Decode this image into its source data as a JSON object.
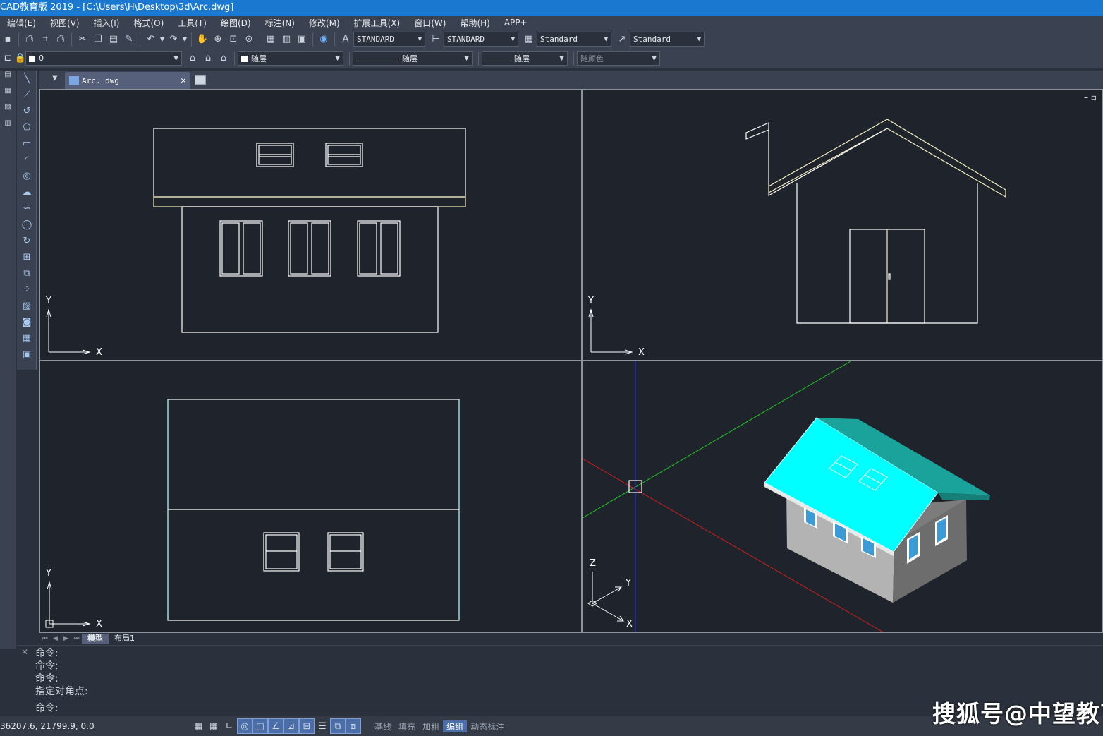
{
  "window": {
    "title": "CAD教育版  2019 - [C:\\Users\\H\\Desktop\\3d\\Arc.dwg]"
  },
  "menu": [
    "编辑(E)",
    "视图(V)",
    "插入(I)",
    "格式(O)",
    "工具(T)",
    "绘图(D)",
    "标注(N)",
    "修改(M)",
    "扩展工具(X)",
    "窗口(W)",
    "帮助(H)",
    "APP+"
  ],
  "toolbar": {
    "text_style": "STANDARD",
    "dim_style": "STANDARD",
    "table_style": "Standard",
    "multileader_style": "Standard"
  },
  "layers": {
    "current_layer": "0",
    "color": "随层",
    "linetype": "随层",
    "lineweight": "随层",
    "plot_style": "随颜色"
  },
  "document_tab": {
    "label": "Arc. dwg"
  },
  "viewports": {
    "front": {
      "axis_x": "X",
      "axis_y": "Y"
    },
    "side": {
      "axis_x": "X",
      "axis_y": "Y"
    },
    "top": {
      "axis_x": "X",
      "axis_y": "Y"
    },
    "iso": {
      "axis_x": "X",
      "axis_y": "Y",
      "axis_z": "Z",
      "roof_color": "#00ffff",
      "roof_side_color": "#1aa39a",
      "wall_color": "#b8b8b8"
    }
  },
  "layout_tabs": [
    "模型",
    "布局1"
  ],
  "command_history": [
    "命令:",
    "命令:",
    "命令:",
    "指定对角点:"
  ],
  "command_prompt": "命令:",
  "status": {
    "coordinates": "36207.6, 21799.9, 0.0",
    "toggles": [
      "基线",
      "填充",
      "加粗",
      "编组",
      "动态标注"
    ],
    "active_toggle": "编组"
  },
  "watermark": "搜狐号@中望教育"
}
